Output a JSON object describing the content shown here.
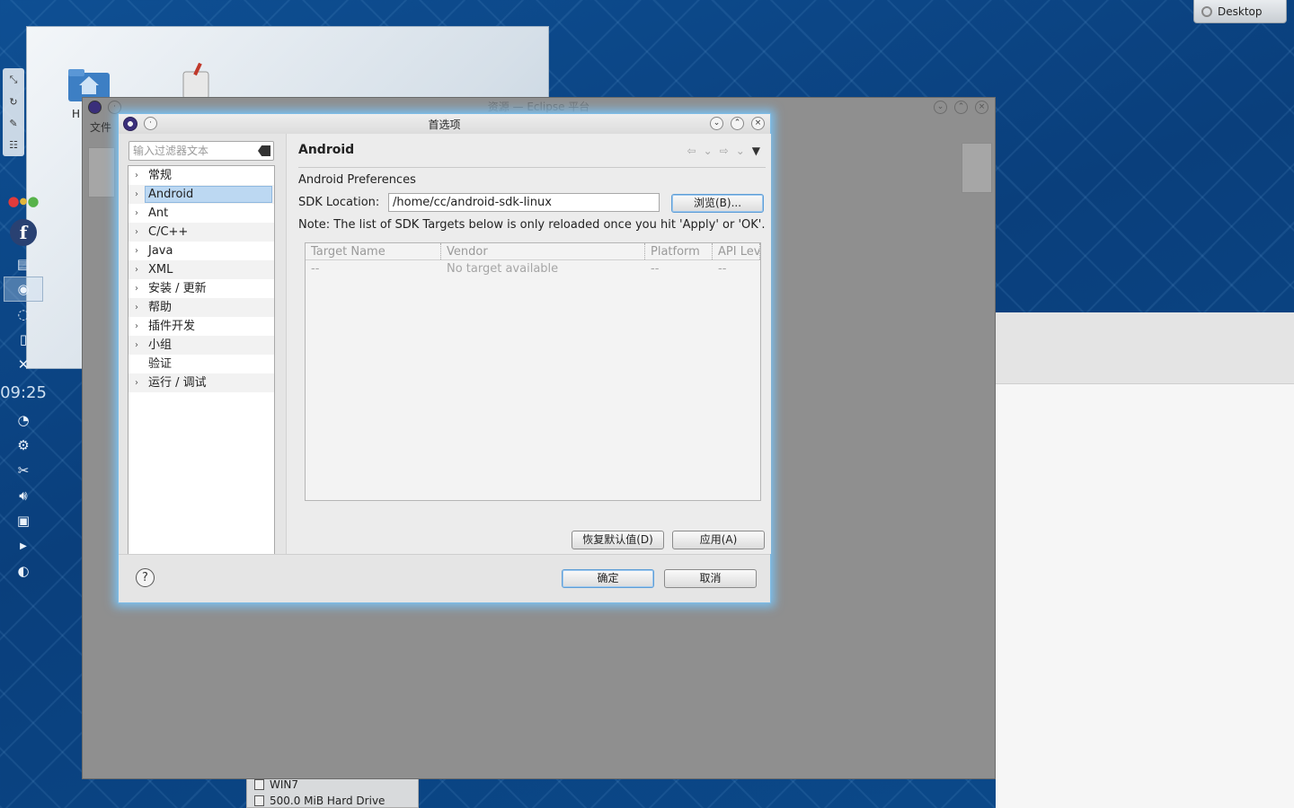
{
  "desktop": {
    "activity_label": "Desktop",
    "folder_widget_label": "H",
    "clock": "09:25",
    "devices": [
      "WIN7",
      "500.0 MiB Hard Drive"
    ]
  },
  "eclipse": {
    "title": "资源 — Eclipse 平台",
    "menu_first": "文件"
  },
  "dialog": {
    "title": "首选项",
    "filter_placeholder": "输入过滤器文本",
    "tree": [
      {
        "label": "常规",
        "expandable": true
      },
      {
        "label": "Android",
        "expandable": true,
        "selected": true
      },
      {
        "label": "Ant",
        "expandable": true
      },
      {
        "label": "C/C++",
        "expandable": true
      },
      {
        "label": "Java",
        "expandable": true
      },
      {
        "label": "XML",
        "expandable": true
      },
      {
        "label": "安装 / 更新",
        "expandable": true
      },
      {
        "label": "帮助",
        "expandable": true
      },
      {
        "label": "插件开发",
        "expandable": true
      },
      {
        "label": "小组",
        "expandable": true
      },
      {
        "label": "验证",
        "expandable": false
      },
      {
        "label": "运行 / 调试",
        "expandable": true
      }
    ],
    "page": {
      "title": "Android",
      "section": "Android Preferences",
      "sdk_label": "SDK Location:",
      "sdk_value": "/home/cc/android-sdk-linux",
      "browse_button": "浏览(B)...",
      "note": "Note: The list of SDK Targets below is only reloaded once you hit 'Apply' or 'OK'.",
      "table": {
        "columns": [
          "Target Name",
          "Vendor",
          "Platform",
          "API Lev"
        ],
        "rows": [
          [
            "--",
            "No target available",
            "--",
            "--"
          ]
        ]
      },
      "restore_button": "恢复默认值(D)",
      "apply_button": "应用(A)"
    },
    "ok_button": "确定",
    "cancel_button": "取消",
    "help_symbol": "?"
  }
}
